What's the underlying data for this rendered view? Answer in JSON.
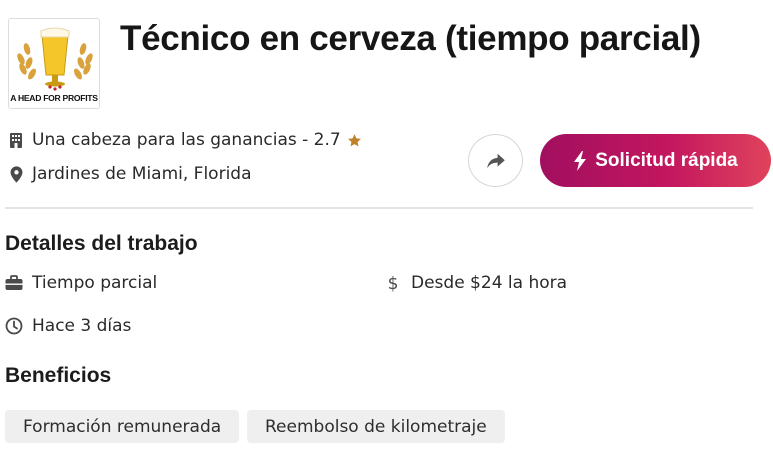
{
  "company": {
    "logo_text": "A HEAD FOR PROFITS",
    "name_rating": "Una cabeza para las ganancias - 2.7",
    "location": "Jardines de Miami, Florida"
  },
  "job": {
    "title": "Técnico en cerveza (tiempo parcial)"
  },
  "actions": {
    "apply_label": "Solicitud rápida"
  },
  "details": {
    "heading": "Detalles del trabajo",
    "job_type": "Tiempo parcial",
    "pay": "Desde $24 la hora",
    "posted": "Hace 3 días"
  },
  "benefits": {
    "heading": "Beneficios",
    "items": [
      "Formación remunerada",
      "Reembolso de kilometraje"
    ]
  },
  "colors": {
    "apply_gradient_start": "#a10f5f",
    "apply_gradient_end": "#e0435c",
    "star": "#c0812b",
    "chip_bg": "#efefef"
  },
  "icons": {
    "building": "building-icon",
    "location": "location-pin-icon",
    "star": "star-icon",
    "share": "share-arrow-icon",
    "bolt": "lightning-bolt-icon",
    "briefcase": "briefcase-icon",
    "dollar": "dollar-icon",
    "clock": "clock-icon"
  }
}
